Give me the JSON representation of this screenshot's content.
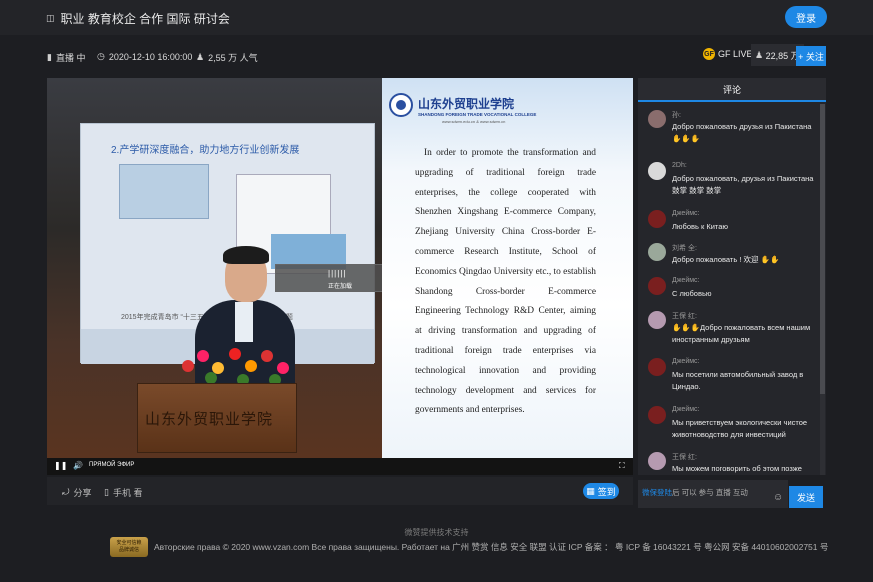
{
  "header": {
    "title": "职业 教育校企 合作 国际 研讨会",
    "login_label": "登录"
  },
  "info": {
    "status": "直播 中",
    "datetime": "2020-12-10 16:00:00",
    "popularity": "2,55 万 人气",
    "channel": "GF LIVE",
    "channel_logo": "GF",
    "followers": "22,85 万",
    "follow_label": "+ 关注"
  },
  "video": {
    "slide_left_title": "2.产学研深度融合，助力地方行业创新发展",
    "slide_left_caption": "2015年完成青岛市 “十三五” ... 数据平台智能大数据课题",
    "overlay_bars": "||||||",
    "overlay_label": "正在加载",
    "podium_text": "山东外贸职业学院",
    "slide_cn_title": "山东外贸职业学院",
    "slide_en_title": "SHANDONG FOREIGN TRADE VOCATIONAL COLLEGE",
    "slide_url": "www.sdwm.edu.cn  &  www.sdwm.cn",
    "slide_body": "In order to promote the transformation and upgrading of traditional foreign trade enterprises, the college cooperated with Shenzhen Xingshang E-commerce Company, Zhejiang University China Cross-border E-commerce Research Institute, School of Economics Qingdao University etc., to establish Shandong Cross-border E-commerce Engineering Technology R&D Center, aiming at driving transformation and upgrading of traditional foreign trade enterprises via technological innovation and providing technology development and services for governments and enterprises.",
    "live_label": "ПРЯМОЙ ЭФИР"
  },
  "actions": {
    "share_label": "分享",
    "mobile_label": "手机 看",
    "signin_label": "签到"
  },
  "comments_panel": {
    "title": "评论",
    "items": [
      {
        "name": "孙:",
        "text": "Добро пожаловать друзья из Пакистана",
        "avatar_color": "#8a6d6d"
      },
      {
        "name": "2Dh:",
        "text": "Добро пожаловать, друзья из Пакистана 鼓掌 鼓掌 鼓掌",
        "avatar_color": "#d9d9d9"
      },
      {
        "name": "Джеймс:",
        "text": "Любовь к Китаю",
        "avatar_color": "#7a1f1f"
      },
      {
        "name": "刘希 全:",
        "text": "Добро пожаловать ! 欢迎",
        "avatar_color": "#9aa89a"
      },
      {
        "name": "Джеймс:",
        "text": "С любовью",
        "avatar_color": "#7a1f1f"
      },
      {
        "name": "王保 红:",
        "text": "Добро пожаловать всем нашим иностранным друзьям",
        "avatar_color": "#b59ab0"
      },
      {
        "name": "Джеймс:",
        "text": "Мы посетили автомобильный завод в Циндао.",
        "avatar_color": "#7a1f1f"
      },
      {
        "name": "Джеймс:",
        "text": "Мы приветствуем экологически чистое животноводство для инвестиций",
        "avatar_color": "#7a1f1f"
      },
      {
        "name": "王保 红:",
        "text": "Мы можем поговорить об этом позже",
        "avatar_color": "#b59ab0"
      }
    ],
    "input_highlight": "微保登陆",
    "input_placeholder": "后 可以 参与 直播 互动",
    "send_label": "发送"
  },
  "footer": {
    "support": "微赞提供技术支持",
    "badge_line1": "安全可信赖",
    "badge_line2": "品牌诚信",
    "copyright": "Авторские права © 2020 www.vzan.com Все права защищены. Работает на 广州 赞赏 信息 安全 联盟 认证 ICP 备案 ： 粤 ICP 备 16043221 号 粤公网 安备 44010602002751 号"
  },
  "colors": {
    "accent": "#1e88e5",
    "background": "#1d1e22",
    "panel": "#25262b"
  }
}
